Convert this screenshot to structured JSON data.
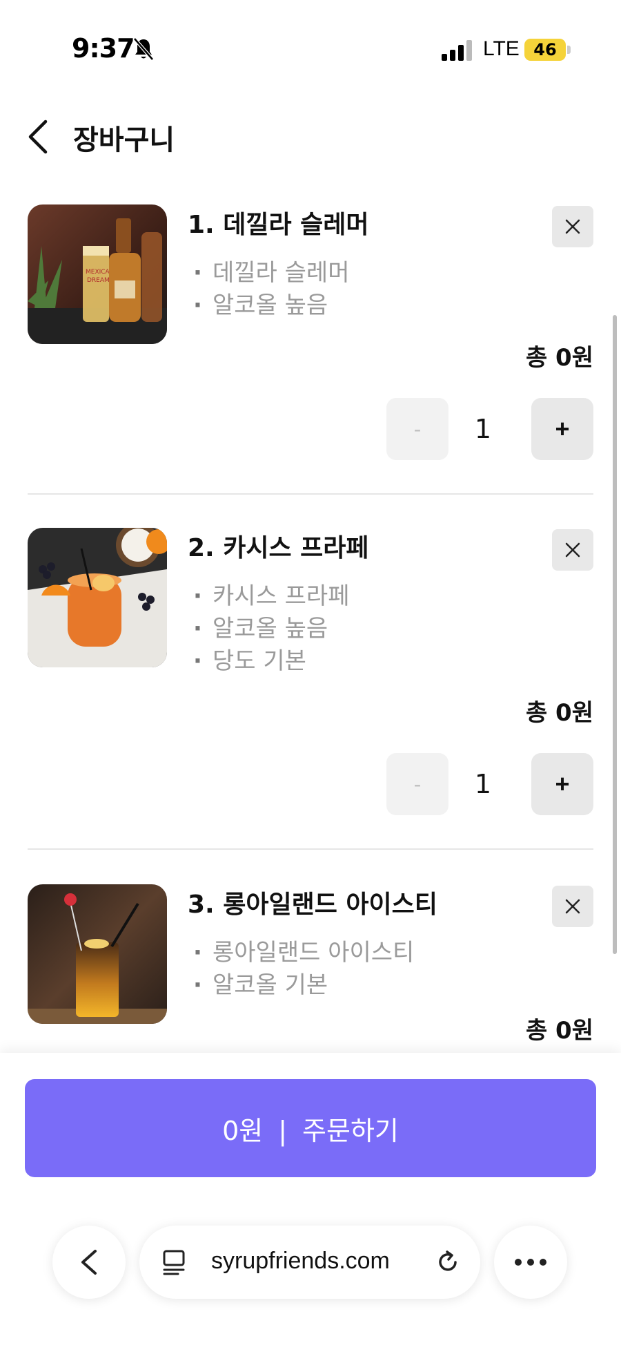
{
  "status_bar": {
    "time": "9:37",
    "network": "LTE",
    "battery": "46"
  },
  "header": {
    "title": "장바구니"
  },
  "cart": {
    "items": [
      {
        "title": "1. 데낄라 슬레머",
        "options": [
          "데낄라 슬레머",
          "알코올 높음"
        ],
        "total": "총 0원",
        "quantity": "1",
        "minus_label": "-",
        "plus_label": "+"
      },
      {
        "title": "2. 카시스 프라페",
        "options": [
          "카시스 프라페",
          "알코올 높음",
          "당도 기본"
        ],
        "total": "총 0원",
        "quantity": "1",
        "minus_label": "-",
        "plus_label": "+"
      },
      {
        "title": "3. 롱아일랜드 아이스티",
        "options": [
          "롱아일랜드 아이스티",
          "알코올 기본"
        ],
        "total": "총 0원"
      }
    ]
  },
  "order": {
    "amount": "0원",
    "separator": "|",
    "label": "주문하기"
  },
  "browser": {
    "url": "syrupfriends.com"
  },
  "colors": {
    "accent": "#7a6cf8",
    "option_text": "#9a9a9a",
    "battery": "#f5d33a"
  }
}
